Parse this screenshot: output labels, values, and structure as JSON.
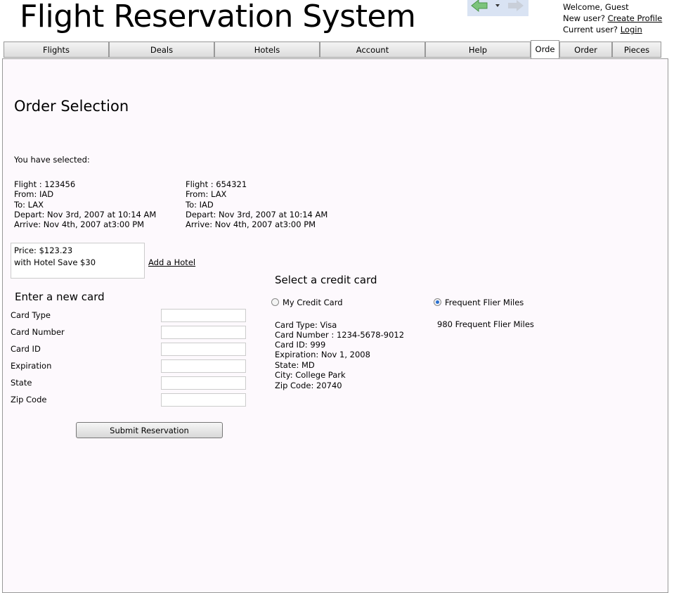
{
  "header": {
    "title": "Flight Reservation System",
    "welcome": "Welcome, Guest",
    "new_user": "New user? ",
    "create_profile": "Create Profile",
    "current_user": "Current user? ",
    "login": "Login"
  },
  "tabs": [
    "Flights",
    "Deals",
    "Hotels",
    "Account",
    "Help",
    "Orde",
    "Order",
    "Pieces"
  ],
  "page": {
    "title": "Order Selection",
    "selected_label": "You have selected:",
    "flights": [
      {
        "flight": "Flight : 123456",
        "from": "From: IAD",
        "to": "To: LAX",
        "depart": "Depart: Nov 3rd, 2007 at 10:14 AM",
        "arrive": "Arrive:  Nov 4th, 2007 at3:00 PM"
      },
      {
        "flight": "Flight : 654321",
        "from": "From: LAX",
        "to": "To: IAD",
        "depart": "Depart: Nov 3rd, 2007 at 10:14 AM",
        "arrive": "Arrive:  Nov 4th, 2007 at3:00 PM"
      }
    ],
    "price": "Price: $123.23",
    "hotel_save": "with Hotel Save $30",
    "add_hotel": "Add a Hotel",
    "new_card": {
      "title": "Enter a new card",
      "fields": [
        "Card Type",
        "Card Number",
        "Card ID",
        "Expiration",
        "State",
        "Zip Code"
      ]
    },
    "submit": "Submit Reservation",
    "credit": {
      "title": "Select a credit card",
      "option1": "My Credit Card",
      "option2": "Frequent Flier Miles",
      "selected": "Frequent Flier Miles",
      "details": [
        "Card Type: Visa",
        "Card Number : 1234-5678-9012",
        "Card ID: 999",
        "Expiration: Nov 1, 2008",
        "State: MD",
        "City: College Park",
        "Zip Code: 20740"
      ],
      "miles": "980 Frequent Flier Miles"
    }
  }
}
